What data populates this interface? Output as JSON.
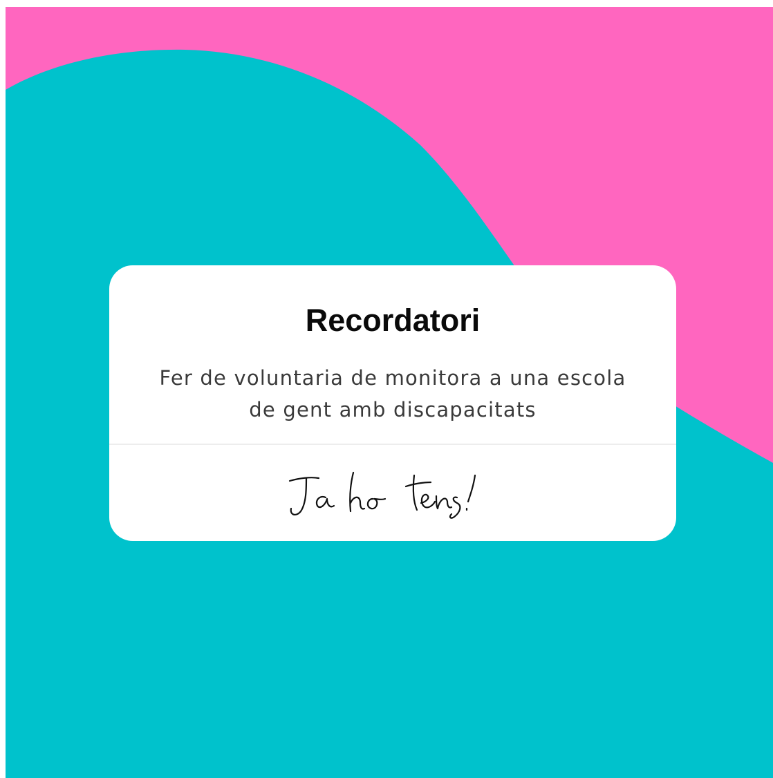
{
  "colors": {
    "pink": "#ff66bf",
    "teal": "#00c2cc",
    "card": "#ffffff",
    "title": "#0a0a0a",
    "body": "#3a3a3a"
  },
  "card": {
    "title": "Recordatori",
    "body": "Fer de voluntaria de monitora a una escola de gent amb discapacitats",
    "signature": "Ja ho tens!"
  }
}
